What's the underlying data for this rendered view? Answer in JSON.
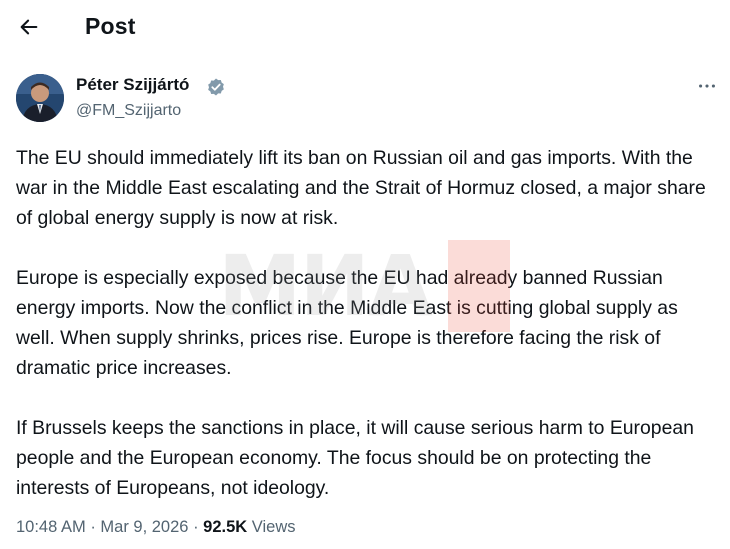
{
  "header": {
    "title": "Post",
    "back_icon": "arrow-left-icon"
  },
  "author": {
    "name": "Péter Szijjártó",
    "handle": "@FM_Szijjarto",
    "verified_icon": "verified-badge-icon",
    "verified_color": "#829aab",
    "more_icon": "more-horizontal-icon"
  },
  "tweet": {
    "paragraphs": [
      "The EU should immediately lift its ban on Russian oil and gas imports. With the war in the Middle East escalating and the Strait of Hormuz closed, a major share of global energy supply is now at risk.",
      "Europe is especially exposed because the EU had already banned Russian energy imports. Now the conflict in the Middle East is cutting global supply as well. When supply shrinks, prices rise. Europe is therefore facing the risk of dramatic price increases.",
      "If Brussels keeps the sanctions in place, it will cause serious harm to European people and the European economy. The focus should be on protecting the interests of Europeans, not ideology."
    ]
  },
  "meta": {
    "time": "10:48 AM",
    "date": "Mar 9, 2026",
    "separator": "·",
    "views_count": "92.5K",
    "views_label": "Views"
  },
  "watermark": {
    "text": "МИА"
  },
  "colors": {
    "text": "#0f1419",
    "secondary": "#536471",
    "background": "#ffffff"
  }
}
